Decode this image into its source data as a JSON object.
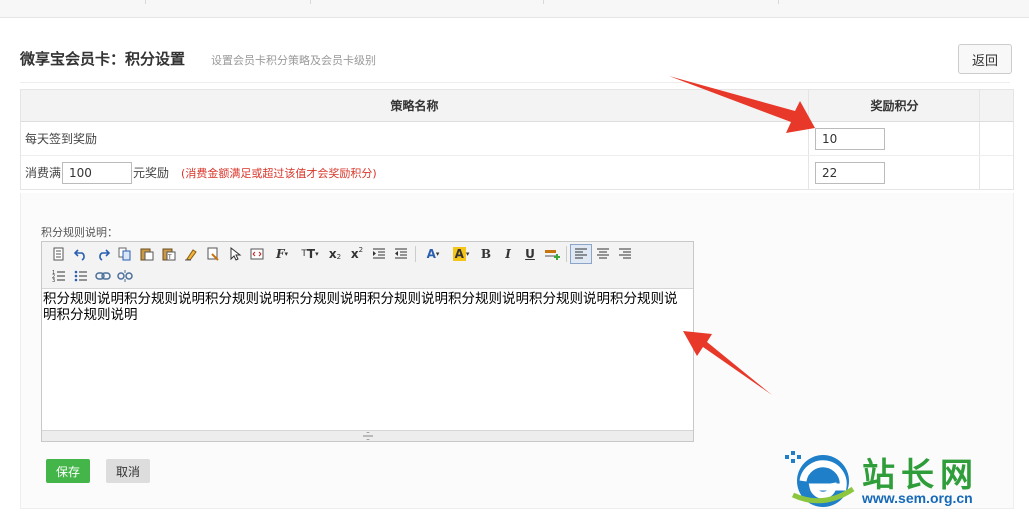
{
  "header": {
    "title": "微享宝会员卡：积分设置",
    "subtitle": "设置会员卡积分策略及会员卡级别",
    "back_label": "返回"
  },
  "table": {
    "columns": [
      "策略名称",
      "奖励积分"
    ],
    "rows": [
      {
        "label": "每天签到奖励",
        "points": "10"
      },
      {
        "label_prefix": "消费满",
        "consume_value": "100",
        "label_suffix": "元奖励",
        "hint": "(消费金额满足或超过该值才会奖励积分)",
        "points": "22"
      }
    ]
  },
  "rules": {
    "label": "积分规则说明：",
    "content": "积分规则说明积分规则说明积分规则说明积分规则说明积分规则说明积分规则说明积分规则说明积分规则说明积分规则说明"
  },
  "toolbar": {
    "row1": [
      "source-icon",
      "undo-icon",
      "redo-icon",
      "copy-icon",
      "paste-icon",
      "paste-text-icon",
      "clear-format-icon",
      "format-brush-icon",
      "select-icon",
      "fullscreen-icon",
      "font-family-icon",
      "font-size-icon",
      "subscript-icon",
      "superscript-icon",
      "indent-icon",
      "outdent-icon",
      "font-color-icon",
      "highlight-color-icon",
      "bold-icon",
      "italic-icon",
      "underline-icon",
      "horizontal-rule-icon",
      "align-left-icon",
      "align-center-icon",
      "align-right-icon"
    ],
    "row2": [
      "ordered-list-icon",
      "unordered-list-icon",
      "link-icon",
      "unlink-icon"
    ]
  },
  "actions": {
    "save_label": "保存",
    "cancel_label": "取消"
  },
  "watermark": {
    "text": "站长网",
    "url": "www.sem.org.cn"
  },
  "colors": {
    "save": "#44b549",
    "hint": "#d9362b",
    "arrow": "#e8382a",
    "watermark_green": "#2f9d3a",
    "watermark_blue": "#1569b8"
  }
}
